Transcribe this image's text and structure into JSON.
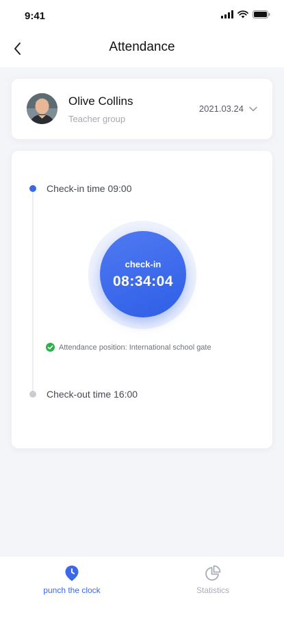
{
  "status_bar": {
    "time": "9:41"
  },
  "header": {
    "title": "Attendance",
    "back_icon": "chevron-left-icon"
  },
  "profile": {
    "name": "Olive Collins",
    "group": "Teacher group",
    "date": "2021.03.24",
    "date_icon": "chevron-down-icon"
  },
  "attendance": {
    "checkin_label": "Check-in time 09:00",
    "checkout_label": "Check-out time 16:00",
    "punch_label": "check-in",
    "punch_time": "08:34:04",
    "position_text": "Attendance position:  International school gate"
  },
  "tabbar": {
    "tabs": [
      {
        "label": "punch the clock",
        "icon": "clock-pin-icon",
        "active": true
      },
      {
        "label": "Statistics",
        "icon": "pie-chart-icon",
        "active": false
      }
    ]
  },
  "colors": {
    "accent": "#3b68e8",
    "background": "#f4f5f9",
    "success": "#2db14a",
    "muted": "#a8acb6"
  }
}
